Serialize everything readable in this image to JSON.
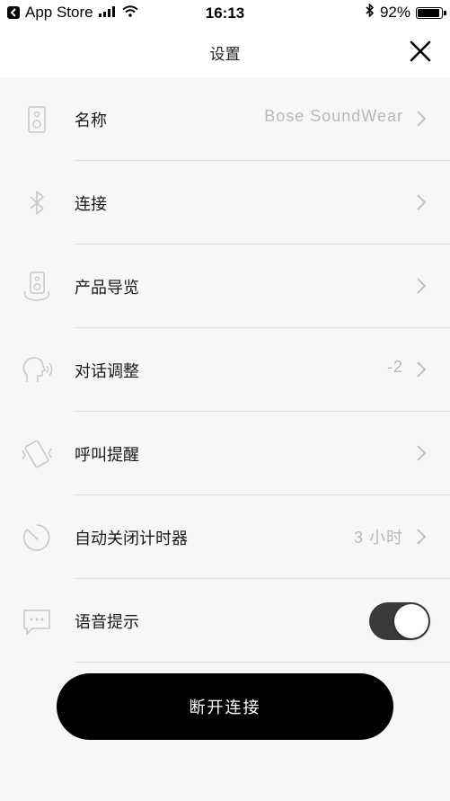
{
  "status_bar": {
    "back_app": "App Store",
    "time": "16:13",
    "battery_text": "92%",
    "battery_level": 0.92
  },
  "header": {
    "title": "设置"
  },
  "settings": [
    {
      "label": "名称",
      "value": "Bose SoundWear",
      "icon": "speaker-icon"
    },
    {
      "label": "连接",
      "value": "",
      "icon": "bluetooth-icon"
    },
    {
      "label": "产品导览",
      "value": "",
      "icon": "product-tour-icon"
    },
    {
      "label": "对话调整",
      "value": "-2",
      "icon": "head-voice-icon"
    },
    {
      "label": "呼叫提醒",
      "value": "",
      "icon": "vibrate-phone-icon"
    },
    {
      "label": "自动关闭计时器",
      "value": "3 小时",
      "icon": "timer-icon"
    },
    {
      "label": "语音提示",
      "value": "",
      "icon": "chat-bubble-icon",
      "toggle_on": true
    }
  ],
  "disconnect_button": {
    "label": "断开连接"
  }
}
